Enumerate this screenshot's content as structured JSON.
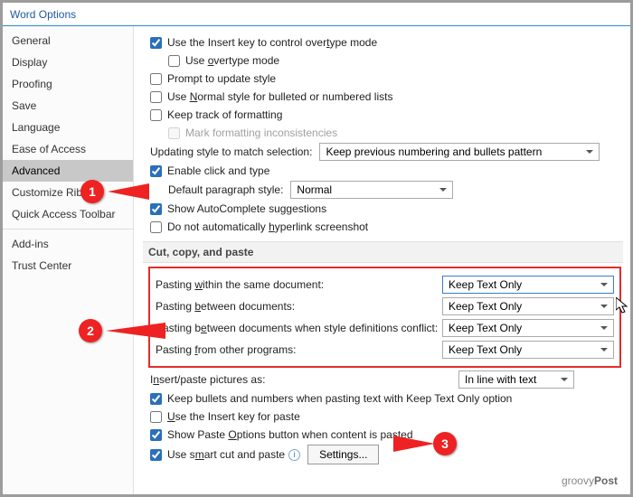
{
  "title": "Word Options",
  "sidebar": {
    "items": [
      {
        "label": "General"
      },
      {
        "label": "Display"
      },
      {
        "label": "Proofing"
      },
      {
        "label": "Save"
      },
      {
        "label": "Language"
      },
      {
        "label": "Ease of Access"
      },
      {
        "label": "Advanced",
        "selected": true
      },
      {
        "label": "Customize Ribbon"
      },
      {
        "label": "Quick Access Toolbar"
      },
      {
        "label": "Add-ins"
      },
      {
        "label": "Trust Center"
      }
    ]
  },
  "editing": {
    "use_insert_key": {
      "checked": true,
      "label_pre": "Use the Insert key to control over",
      "u": "t",
      "label_post": "ype mode"
    },
    "use_overtype": {
      "checked": false,
      "label_pre": "Use ",
      "u": "o",
      "label_post": "vertype mode"
    },
    "prompt_update_style": {
      "checked": false,
      "label_pre": "Prompt to update style"
    },
    "normal_style_lists": {
      "checked": false,
      "label_pre": "Use ",
      "u": "N",
      "label_post": "ormal style for bulleted or numbered lists"
    },
    "keep_track_format": {
      "checked": false,
      "label_pre": "Keep track of formatting"
    },
    "mark_inconsistencies": {
      "checked": false,
      "label_pre": "Mark formatting inconsistencies"
    },
    "updating_style_label": "Updating style to match selection:",
    "updating_style_value": "Keep previous numbering and bullets pattern",
    "enable_click_type": {
      "checked": true,
      "label_pre": "Enable click and type"
    },
    "default_para_label": "Default paragraph style:",
    "default_para_value": "Normal",
    "autocomplete": {
      "checked": true,
      "label_pre": "Show AutoComplete suggestions"
    },
    "no_hyperlink_ss": {
      "checked": false,
      "label_pre": "Do not automatically ",
      "u": "h",
      "label_post": "yperlink screenshot"
    }
  },
  "section_cut": "Cut, copy, and paste",
  "paste": {
    "rows": [
      {
        "label_pre": "Pasting ",
        "u": "w",
        "label_post": "ithin the same document:",
        "value": "Keep Text Only"
      },
      {
        "label_pre": "Pasting ",
        "u": "b",
        "label_post": "etween documents:",
        "value": "Keep Text Only"
      },
      {
        "label_pre": "Pasting b",
        "u": "e",
        "label_post": "tween documents when style definitions conflict:",
        "value": "Keep Text Only"
      },
      {
        "label_pre": "Pasting ",
        "u": "f",
        "label_post": "rom other programs:",
        "value": "Keep Text Only"
      }
    ]
  },
  "below": {
    "insert_pictures_label_pre": "I",
    "insert_pictures_u": "n",
    "insert_pictures_label_post": "sert/paste pictures as:",
    "insert_pictures_value": "In line with text",
    "keep_bullets": {
      "checked": true,
      "label_pre": "Keep bullets and numbers when pasting text with Keep Text Only option"
    },
    "insert_key_paste": {
      "checked": false,
      "label_pre": "",
      "u": "U",
      "label_post": "se the Insert key for paste"
    },
    "show_paste_options": {
      "checked": true,
      "label_pre": "Show Paste ",
      "u": "O",
      "label_post": "ptions button when content is pasted"
    },
    "smart_cut": {
      "checked": true,
      "label_pre": "Use s",
      "u": "m",
      "label_post": "art cut and paste"
    },
    "settings_btn": "Settings..."
  },
  "callouts": {
    "c1": "1",
    "c2": "2",
    "c3": "3"
  },
  "watermark": {
    "a": "groovy",
    "b": "Post"
  }
}
